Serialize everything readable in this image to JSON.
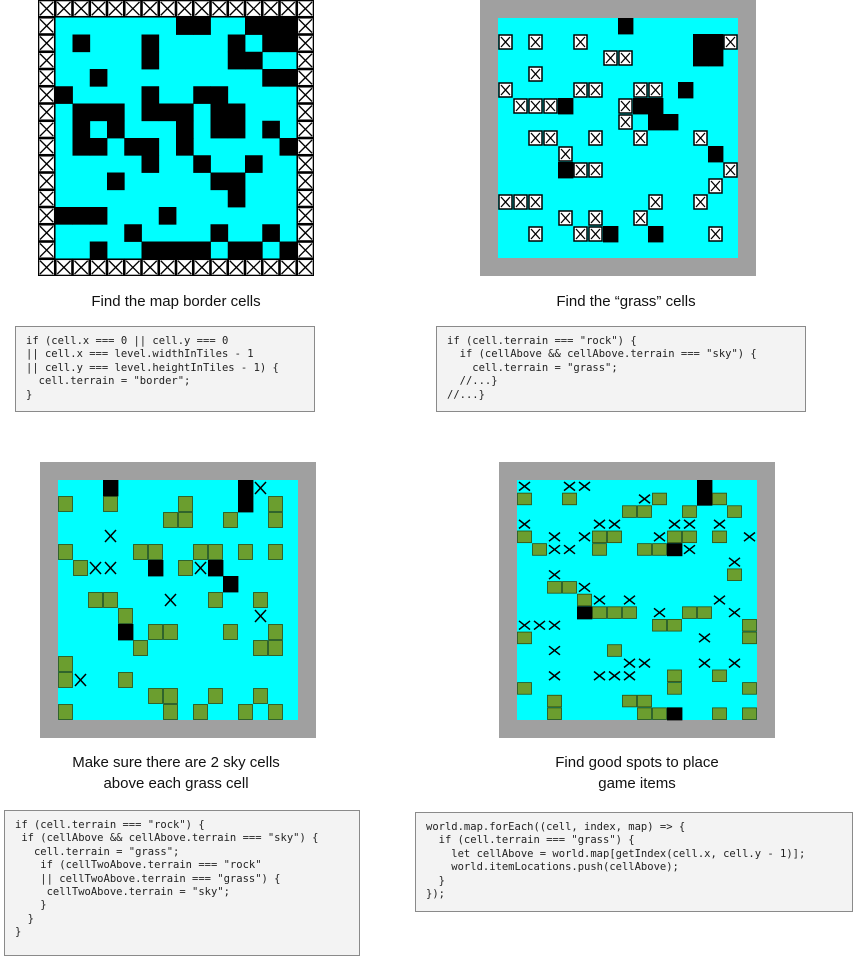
{
  "panels": [
    {
      "id": "border",
      "caption": "Find the map border cells",
      "code": "if (cell.x === 0 || cell.y === 0\n|| cell.x === level.widthInTiles - 1\n|| cell.y === level.heightInTiles - 1) {\n  cell.terrain = \"border\";\n}",
      "frame_color": "#000000",
      "map": [
        "BBBBBBBBBBBBBBBB",
        "B.......RR..RRRB",
        "B.R...R....R.RRB",
        "B.....R....RR..B",
        "B..R.........RRB",
        "BR....R..RR....B",
        "B.RRR.RRR.RR...B",
        "B.R.R...R.RR.R.B",
        "B.RR.RR.R.....RB",
        "B.....R..R..R..B",
        "B...R.....RR...B",
        "B..........R...B",
        "BRRR...R.......B",
        "B....R....R..R.B",
        "B..R..RRRR.RR.RB",
        "BBBBBBBBBBBBBBBB"
      ]
    },
    {
      "id": "grass",
      "caption": "Find the “grass” cells",
      "code": "if (cell.terrain === \"rock\") {\n  if (cellAbove && cellAbove.terrain === \"sky\") {\n    cell.terrain = \"grass\";\n  //...}\n//...}",
      "frame_color": "#a0a0a0",
      "map": [
        "........R.......",
        "G.G..G.......RRG",
        ".......GG....RR.",
        "..G.............",
        "G....GG..GG.R...",
        ".GGGR...GRR.....",
        "........G.RR....",
        "..GG..G..G...G..",
        "....G.........R.",
        "....RGG........G",
        "..............G.",
        "GGG.......G..G..",
        "....G.G..G......",
        "..G..GGR..R...G.",
        "................"
      ]
    },
    {
      "id": "sky",
      "caption": "Make sure there are 2 sky cells\nabove each grass cell",
      "code": "if (cell.terrain === \"rock\") {\n if (cellAbove && cellAbove.terrain === \"sky\") {\n   cell.terrain = \"grass\";\n    if (cellTwoAbove.terrain === \"rock\"\n    || cellTwoAbove.terrain === \"grass\") {\n     cellTwoAbove.terrain = \"sky\";\n    }\n  }\n}",
      "frame_color": "#a0a0a0",
      "map": [
        "...R........RX..",
        "G..G....G...R.G.",
        ".......GG..G..G.",
        "...X............",
        "G....GG..GG.G.G.",
        ".GXX..R.GXR.....",
        "...........R....",
        "..GG...X..G..G..",
        "....G........X..",
        "....R.GG...G..G.",
        ".....G.......GG.",
        "G...............",
        "GX..G...........",
        "......GG..G..G..",
        "G......G.G..G.G."
      ]
    },
    {
      "id": "items",
      "caption": "Find good spots to place\ngame items",
      "code": "world.map.forEach((cell, index, map) => {\n  if (cell.terrain === \"grass\") {\n    let cellAbove = world.map[getIndex(cell.x, cell.y - 1)];\n    world.itemLocations.push(cellAbove);\n  }\n});",
      "frame_color": "#a0a0a0",
      "map": [
        "X..XX.......R...",
        "G..G....XG..RG..",
        ".......GG..G..G.",
        "X....XX...XX.X..",
        "G.X.XGG..XGG.G.X",
        ".GXX.G..GGRX....",
        "..............X.",
        "..X...........G.",
        "..GGX...........",
        "....GX.X.....X..",
        "....RGGG.X.GG.X.",
        "XXX......GG....G",
        "G...........X..G",
        "..X...G.........",
        ".......XX...X.X.",
        "..X..XXX..G..G..",
        "G.........G....G",
        "..G....GG.......",
        "..G.....GGR..G.G"
      ]
    }
  ],
  "cell_colors": {
    "sky": "#00ffff",
    "rock": "#000000",
    "grass": "#6b9e2f",
    "item_marker": "#000000",
    "frame_gray": "#a0a0a0",
    "border_fill": "#ffffff"
  },
  "legend_symbols": {
    "border_cell": "x-box-icon",
    "grass_marker": "x-box-icon",
    "item_spot": "x-mark-icon"
  }
}
